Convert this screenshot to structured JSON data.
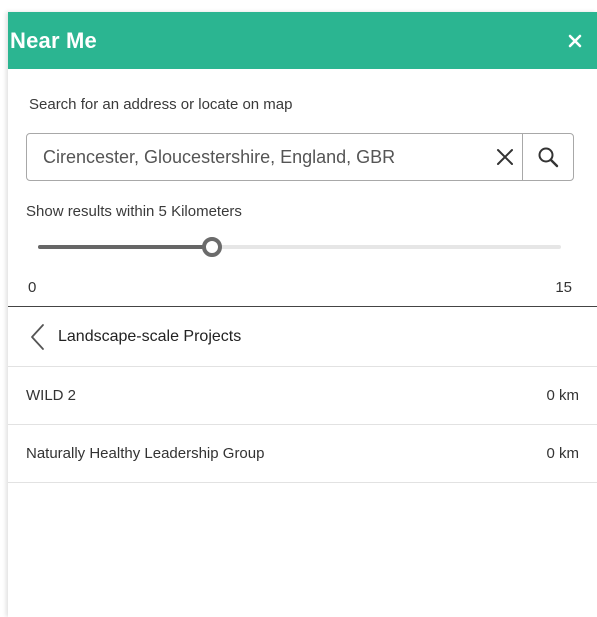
{
  "colors": {
    "header_bg": "#2bb591",
    "header_text": "#ffffff",
    "slider_fill": "#666666",
    "slider_track": "#e6e6e6"
  },
  "header": {
    "title": "Near Me",
    "close_icon": "close-icon"
  },
  "search": {
    "label": "Search for an address or locate on map",
    "value": "Cirencester, Gloucestershire, England, GBR",
    "clear_icon": "clear-x-icon",
    "search_icon": "search-icon"
  },
  "radius": {
    "label": "Show results within 5 Kilometers",
    "min": 0,
    "max": 15,
    "value": 5,
    "min_label": "0",
    "max_label": "15"
  },
  "category": {
    "back_icon": "chevron-left-icon",
    "title": "Landscape-scale Projects"
  },
  "results": [
    {
      "name": "WILD 2",
      "distance": "0 km"
    },
    {
      "name": "Naturally Healthy Leadership Group",
      "distance": "0 km"
    }
  ]
}
